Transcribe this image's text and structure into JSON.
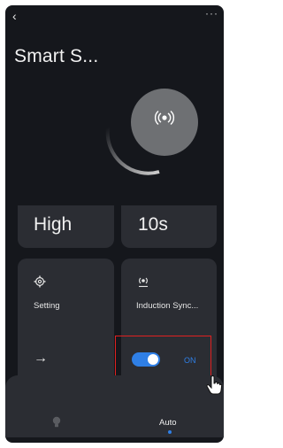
{
  "header": {
    "back_icon": "chevron-left",
    "more_icon": "more-horizontal",
    "more_glyph": "···",
    "title": "Smart S..."
  },
  "dial": {
    "icon": "radio-waves-icon"
  },
  "cards": {
    "sensitivity": {
      "value": "High"
    },
    "duration": {
      "value": "10s"
    },
    "setting": {
      "label": "Setting",
      "icon": "gear-icon",
      "arrow": "→"
    },
    "induction": {
      "label": "Induction Sync...",
      "icon": "induction-sync-icon",
      "toggle_state": true,
      "toggle_label": "ON"
    }
  },
  "bottom_nav": {
    "items": [
      {
        "icon": "bulb-icon",
        "label": ""
      },
      {
        "label": "Auto",
        "active": true
      }
    ]
  },
  "colors": {
    "background": "#15171c",
    "card": "#2b2d33",
    "accent": "#2f7fe6",
    "highlight": "#e02020"
  }
}
